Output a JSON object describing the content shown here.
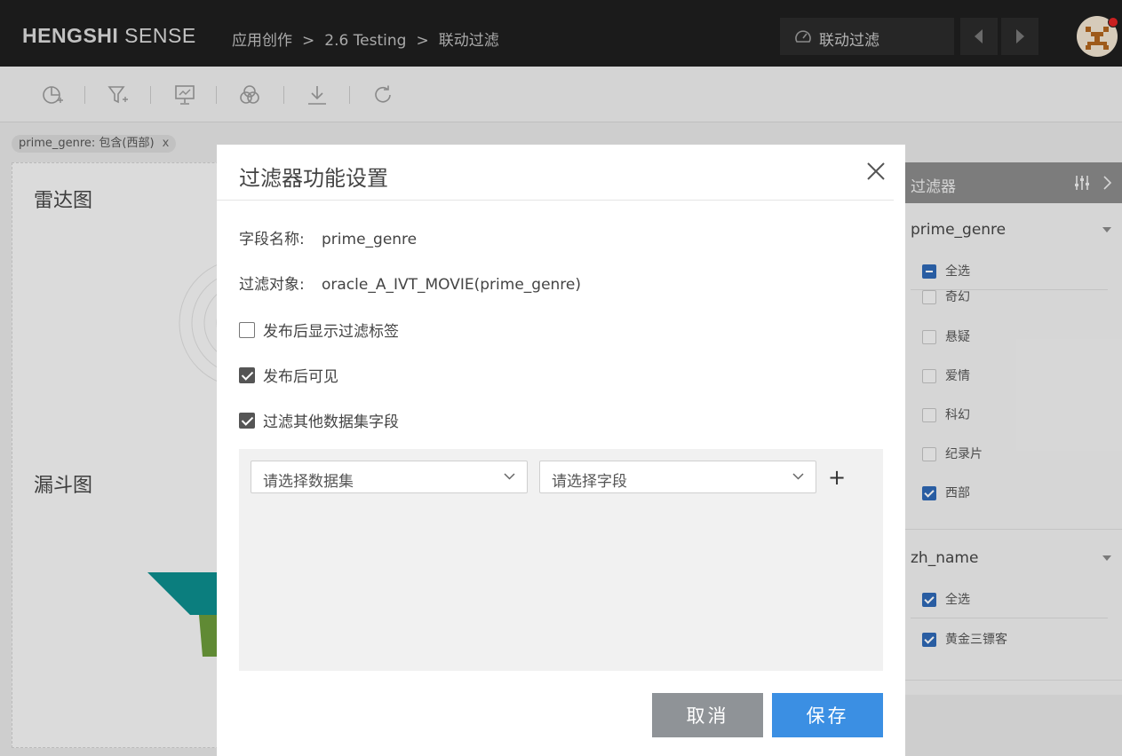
{
  "brand": {
    "bold": "HENGSHI",
    "light": " SENSE"
  },
  "breadcrumb": [
    "应用创作",
    "2.6 Testing",
    "联动过滤"
  ],
  "breadcrumb_sep": ">",
  "mode_label": "联动过滤",
  "filter_tag": {
    "label": "prime_genre: 包含(西部)",
    "close": "x"
  },
  "panels": {
    "radar_title": "雷达图",
    "funnel_title": "漏斗图"
  },
  "filter_panel": {
    "title": "过滤器",
    "groups": [
      {
        "field": "prime_genre",
        "select_all": "全选",
        "items": [
          {
            "label": "奇幻",
            "checked": false
          },
          {
            "label": "悬疑",
            "checked": false
          },
          {
            "label": "爱情",
            "checked": false
          },
          {
            "label": "科幻",
            "checked": false
          },
          {
            "label": "纪录片",
            "checked": false
          },
          {
            "label": "西部",
            "checked": true
          }
        ]
      },
      {
        "field": "zh_name",
        "select_all": "全选",
        "items": [
          {
            "label": "黄金三镖客",
            "checked": true
          }
        ]
      }
    ]
  },
  "modal": {
    "title": "过滤器功能设置",
    "field_name_label": "字段名称:",
    "field_name_value": "prime_genre",
    "filter_target_label": "过滤对象:",
    "filter_target_value": "oracle_A_IVT_MOVIE(prime_genre)",
    "options": [
      {
        "label": "发布后显示过滤标签",
        "checked": false
      },
      {
        "label": "发布后可见",
        "checked": true
      },
      {
        "label": "过滤其他数据集字段",
        "checked": true
      }
    ],
    "dataset_placeholder": "请选择数据集",
    "field_placeholder": "请选择字段",
    "add_symbol": "+",
    "cancel_label": "取消",
    "save_label": "保存"
  },
  "colors": {
    "funnel_top": "#0d8d8d",
    "funnel_mid": "#6b9a3a",
    "primary": "#3b8fe3",
    "checkbox": "#2e68b5"
  }
}
